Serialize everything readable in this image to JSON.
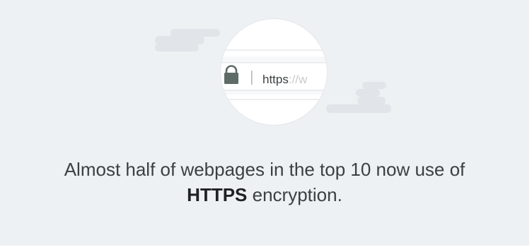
{
  "illustration": {
    "url_prefix": "https",
    "url_rest": "://w",
    "icon": "lock-icon",
    "colors": {
      "background": "#eef1f4",
      "cloud": "#e1e4e8",
      "lens_fill": "#ffffff",
      "lens_border": "#e3e6ea",
      "lock": "#5f6b66",
      "url_dark": "#3c4043",
      "url_light": "#c7cacd"
    }
  },
  "caption": {
    "line1": "Almost half of webpages in the top 10 now use of",
    "strong": "HTTPS",
    "line2_rest": " encryption."
  }
}
